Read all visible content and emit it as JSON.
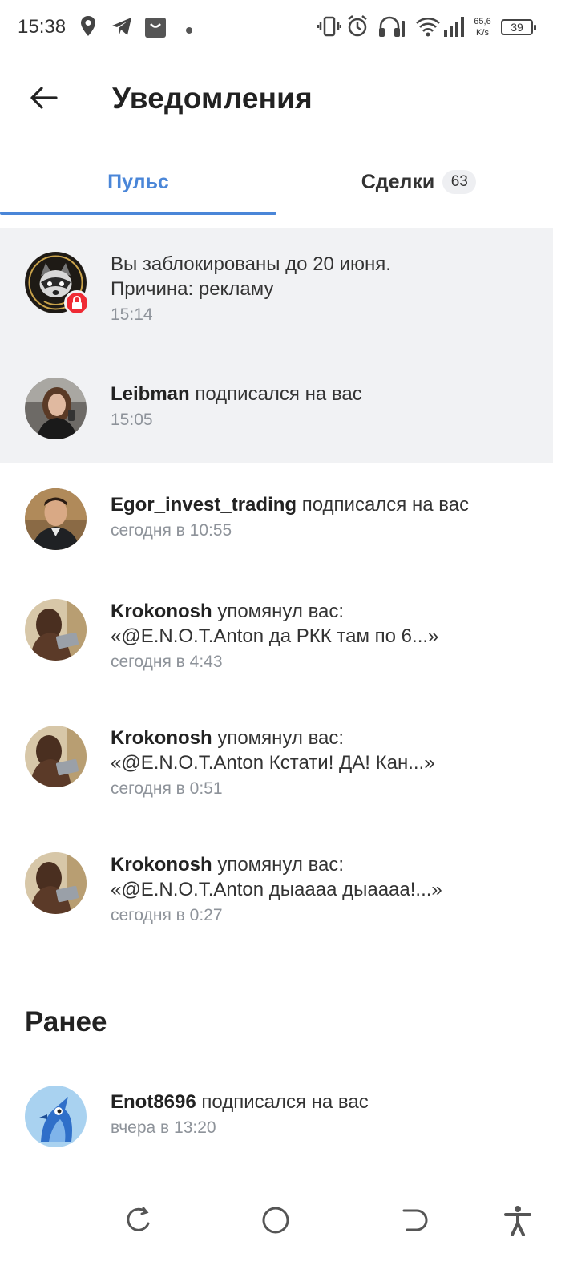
{
  "status_bar": {
    "time": "15:38",
    "net_speed_value": "65,6",
    "net_speed_unit": "K/s",
    "battery": "39"
  },
  "header": {
    "title": "Уведомления"
  },
  "tabs": [
    {
      "label": "Пульс",
      "active": true
    },
    {
      "label": "Сделки",
      "badge": "63",
      "active": false
    }
  ],
  "notifications": [
    {
      "line1": "Вы заблокированы до 20 июня.",
      "line2": "Причина: рекламу",
      "time": "15:14",
      "unread": true,
      "avatar": "raccoon-avatar",
      "badge_icon": "lock-icon"
    },
    {
      "user": "Leibman",
      "action": " подписался на вас",
      "time": "15:05",
      "unread": true,
      "avatar": "woman-avatar"
    },
    {
      "user": "Egor_invest_trading",
      "action": " подписался на вас",
      "time": "сегодня в 10:55",
      "unread": false,
      "avatar": "man-avatar"
    },
    {
      "user": "Krokonosh",
      "action": " упомянул вас:",
      "quote": "«@E.N.O.T.Anton да РКК там по 6...»",
      "time": "сегодня в 4:43",
      "unread": false,
      "avatar": "person-laptop-avatar"
    },
    {
      "user": "Krokonosh",
      "action": " упомянул вас:",
      "quote": "«@E.N.O.T.Anton Кстати! ДА! Кан...»",
      "time": "сегодня в 0:51",
      "unread": false,
      "avatar": "person-laptop-avatar"
    },
    {
      "user": "Krokonosh",
      "action": " упомянул вас:",
      "quote": "«@E.N.O.T.Anton дыаааа дыаааа!...»",
      "time": "сегодня в 0:27",
      "unread": false,
      "avatar": "person-laptop-avatar"
    }
  ],
  "earlier": {
    "title": "Ранее",
    "items": [
      {
        "user": "Enot8696",
        "action": " подписался на вас",
        "time": "вчера в 13:20",
        "avatar": "bird-avatar"
      }
    ]
  },
  "colors": {
    "accent": "#4a86d8",
    "unread_bg": "#f1f2f4",
    "lock_badge": "#ef2b34",
    "secondary_text": "#8e939a"
  }
}
